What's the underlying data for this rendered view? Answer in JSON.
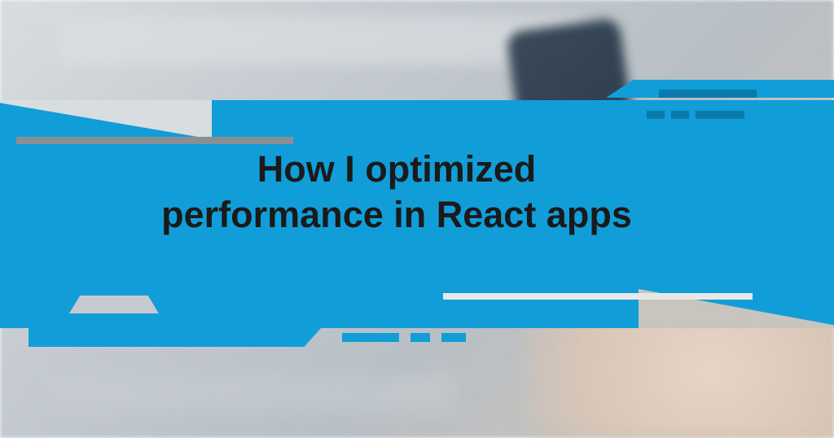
{
  "banner": {
    "title": "How I optimized performance in React apps",
    "accent_color": "#119dd8",
    "text_color": "#1a1a1a"
  }
}
